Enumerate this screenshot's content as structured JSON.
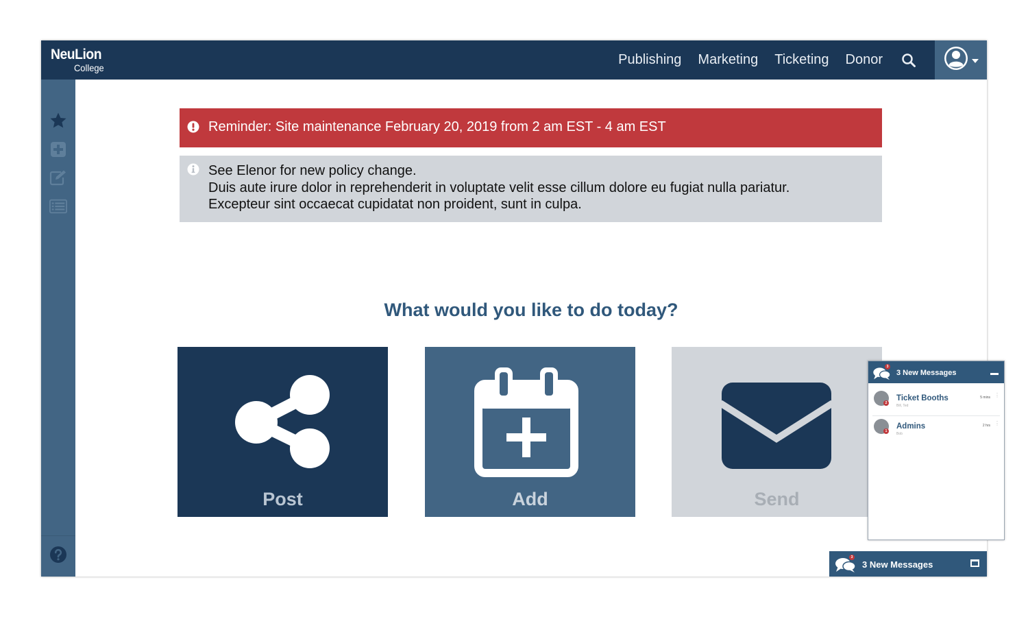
{
  "app": {
    "brand": "NeuLion",
    "brand_sub": "College"
  },
  "nav": {
    "items": [
      "Publishing",
      "Marketing",
      "Ticketing",
      "Donor"
    ],
    "search_icon": "search-icon",
    "user_icon": "user-circle-icon"
  },
  "sidebar": {
    "items": [
      {
        "icon": "star-icon"
      },
      {
        "icon": "plus-square-icon"
      },
      {
        "icon": "edit-icon"
      },
      {
        "icon": "list-icon"
      }
    ],
    "help_icon": "help-icon"
  },
  "alerts": {
    "maintenance": {
      "text": "Reminder: Site maintenance February 20, 2019 from 2 am EST - 4 am EST",
      "color": "#c0393d"
    },
    "info": {
      "line1": "See Elenor for new policy change.",
      "line2": "Duis aute irure dolor in reprehenderit in voluptate velit esse cillum dolore eu fugiat nulla pariatur. Excepteur sint occaecat cupidatat non proident, sunt in culpa."
    }
  },
  "main": {
    "heading": "What would you like to do today?",
    "tiles": [
      {
        "label": "Post",
        "icon": "share-icon",
        "color": "#1b3756"
      },
      {
        "label": "Add",
        "icon": "calendar-plus-icon",
        "color": "#426584"
      },
      {
        "label": "Send",
        "icon": "envelope-icon",
        "color": "#d1d5da"
      }
    ]
  },
  "chat": {
    "bar_label": "3 New Messages",
    "badge": "3",
    "popup_title": "3 New Messages",
    "conversations": [
      {
        "name": "Ticket Booths",
        "members": "Bill, Ted",
        "time": "5 mins",
        "unread": "2"
      },
      {
        "name": "Admins",
        "members": "Bob",
        "time": "2 hrs",
        "unread": "1"
      }
    ]
  },
  "colors": {
    "navy": "#1b3756",
    "slate": "#426584",
    "alert_red": "#c0393d",
    "grey": "#d1d5da"
  }
}
